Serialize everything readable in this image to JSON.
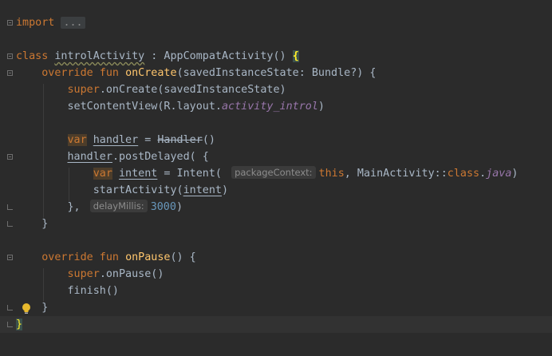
{
  "editor": {
    "lines": {
      "l1": {
        "kw": "import",
        "fold": "..."
      },
      "l3": {
        "kw": "class",
        "name": "introlActivity",
        "rest": " : AppCompatActivity() ",
        "brace": "{"
      },
      "l4": {
        "kw": "override fun ",
        "fn": "onCreate",
        "rest": "(savedInstanceState: Bundle?) {"
      },
      "l5": {
        "kw": "super",
        "rest": ".onCreate(savedInstanceState)"
      },
      "l6": {
        "a": "setContentView(R.layout.",
        "it": "activity_introl",
        "b": ")"
      },
      "l8": {
        "kw": "var",
        "name": "handler",
        "eq": " = ",
        "cls": "Handler",
        "b": "()"
      },
      "l9": {
        "name": "handler",
        "rest": ".postDelayed( {"
      },
      "l10": {
        "kw": "var",
        "name": "intent",
        "a": " = Intent( ",
        "hint": "packageContext:",
        "kw2": "this",
        "b": ", MainActivity::",
        "kw3": "class",
        "c": ".",
        "it": "java",
        "d": ")"
      },
      "l11": {
        "a": "startActivity(",
        "name": "intent",
        "b": ")"
      },
      "l12": {
        "a": "}, ",
        "hint": "delayMillis:",
        "num": "3000",
        "b": ")"
      },
      "l13": {
        "a": "}"
      },
      "l15": {
        "kw": "override fun ",
        "fn": "onPause",
        "rest": "() {"
      },
      "l16": {
        "kw": "super",
        "rest": ".onPause()"
      },
      "l17": {
        "a": "finish()"
      },
      "l18": {
        "a": "}"
      },
      "l19": {
        "brace": "}"
      }
    }
  },
  "icons": {
    "bulb": "lightbulb-icon",
    "fold": "fold-marker-icon"
  },
  "colors": {
    "background": "#2b2b2b",
    "keyword": "#cc7832",
    "function": "#ffc66d",
    "number": "#6897bb",
    "italic": "#9876aa",
    "text": "#a9b7c6"
  }
}
